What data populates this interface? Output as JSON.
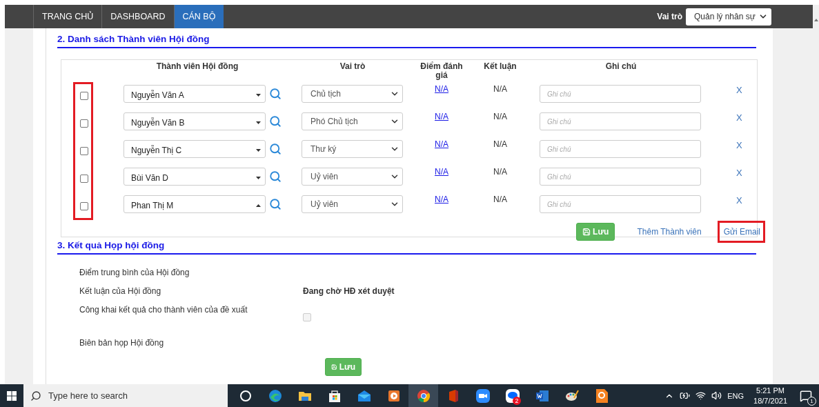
{
  "nav": {
    "tabs": [
      {
        "label": "TRANG CHỦ",
        "selected": false
      },
      {
        "label": "DASHBOARD",
        "selected": false
      },
      {
        "label": "CÁN BỘ",
        "selected": true
      }
    ],
    "role_label": "Vai trò",
    "role_value": "Quản lý nhân sự"
  },
  "members_section": {
    "title": "2. Danh sách Thành viên Hội đồng",
    "columns": [
      "Thành viên Hội đồng",
      "Vai trò",
      "Điểm đánh giá",
      "Kết luận",
      "Ghi chú"
    ],
    "checkbox_column_highlighted": true,
    "rows": [
      {
        "checked": false,
        "member": "Nguyễn Văn A",
        "expanded": false,
        "role": "Chủ tịch",
        "score": "N/A",
        "conclusion": "N/A",
        "note_placeholder": "Ghi chú",
        "remove": "X"
      },
      {
        "checked": false,
        "member": "Nguyễn Văn B",
        "expanded": false,
        "role": "Phó Chủ tịch",
        "score": "N/A",
        "conclusion": "N/A",
        "note_placeholder": "Ghi chú",
        "remove": "X"
      },
      {
        "checked": false,
        "member": "Nguyễn Thị C",
        "expanded": false,
        "role": "Thư ký",
        "score": "N/A",
        "conclusion": "N/A",
        "note_placeholder": "Ghi chú",
        "remove": "X"
      },
      {
        "checked": false,
        "member": "Bùi Văn D",
        "expanded": false,
        "role": "Uỷ viên",
        "score": "N/A",
        "conclusion": "N/A",
        "note_placeholder": "Ghi chú",
        "remove": "X"
      },
      {
        "checked": false,
        "member": "Phan Thị M",
        "expanded": true,
        "role": "Uỷ viên",
        "score": "N/A",
        "conclusion": "N/A",
        "note_placeholder": "Ghi chú",
        "remove": "X"
      }
    ],
    "save_button": "Lưu",
    "add_link": "Thêm Thành viên",
    "email_link": {
      "label": "Gửi Email",
      "highlighted": true
    }
  },
  "result_section": {
    "title": "3. Kết quả Họp hội đồng",
    "fields": [
      {
        "kind": "text",
        "label": "Điểm trung bình của Hội đồng"
      },
      {
        "kind": "text",
        "label": "Kết luận của Hội đồng",
        "value": "Đang chờ HĐ xét duyệt"
      },
      {
        "kind": "checkbox",
        "label": "Công khai kết quả cho thành viên của đề xuất",
        "checked": false
      },
      {
        "kind": "text",
        "label": "Biên bản họp Hội đồng"
      }
    ],
    "save_button": "Lưu"
  },
  "taskbar": {
    "search_placeholder": "Type here to search",
    "apps": [
      {
        "kind": "cortana",
        "selected": false
      },
      {
        "kind": "edge",
        "selected": false
      },
      {
        "kind": "explorer",
        "selected": false
      },
      {
        "kind": "store",
        "selected": false
      },
      {
        "kind": "mail",
        "selected": false
      },
      {
        "kind": "media",
        "selected": false
      },
      {
        "kind": "chrome",
        "selected": true
      },
      {
        "kind": "office",
        "selected": false
      },
      {
        "kind": "zoom",
        "selected": false
      },
      {
        "kind": "zalo",
        "selected": false,
        "badge": "2"
      },
      {
        "kind": "word",
        "selected": false
      },
      {
        "kind": "paint",
        "selected": false
      },
      {
        "kind": "pdf",
        "selected": false
      }
    ],
    "language": "ENG",
    "time": "5:21 PM",
    "date": "18/7/2021",
    "notification_count": "1"
  }
}
